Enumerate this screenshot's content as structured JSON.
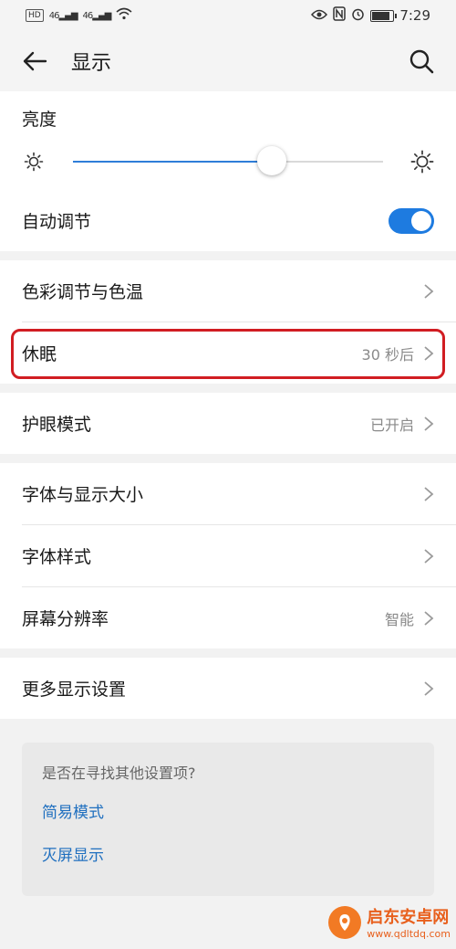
{
  "status_bar": {
    "left_badge": "HD",
    "signal1": "46",
    "signal2": "46",
    "time": "7:29",
    "battery_level": 0.85
  },
  "header": {
    "title": "显示"
  },
  "brightness": {
    "label": "亮度",
    "level": 0.64
  },
  "auto_adjust": {
    "label": "自动调节",
    "enabled": true
  },
  "settings": {
    "color_temp": "色彩调节与色温",
    "sleep": {
      "label": "休眠",
      "value": "30 秒后"
    },
    "eye_comfort": {
      "label": "护眼模式",
      "value": "已开启"
    },
    "font_size": "字体与显示大小",
    "font_style": "字体样式",
    "resolution": {
      "label": "屏幕分辨率",
      "value": "智能"
    },
    "more": "更多显示设置"
  },
  "suggestions": {
    "question": "是否在寻找其他设置项?",
    "links": [
      "简易模式",
      "灭屏显示"
    ]
  },
  "watermark": {
    "title": "启东安卓网",
    "url": "www.qdltdq.com"
  },
  "colors": {
    "accent": "#1e7be0",
    "highlight": "#d11d22"
  }
}
